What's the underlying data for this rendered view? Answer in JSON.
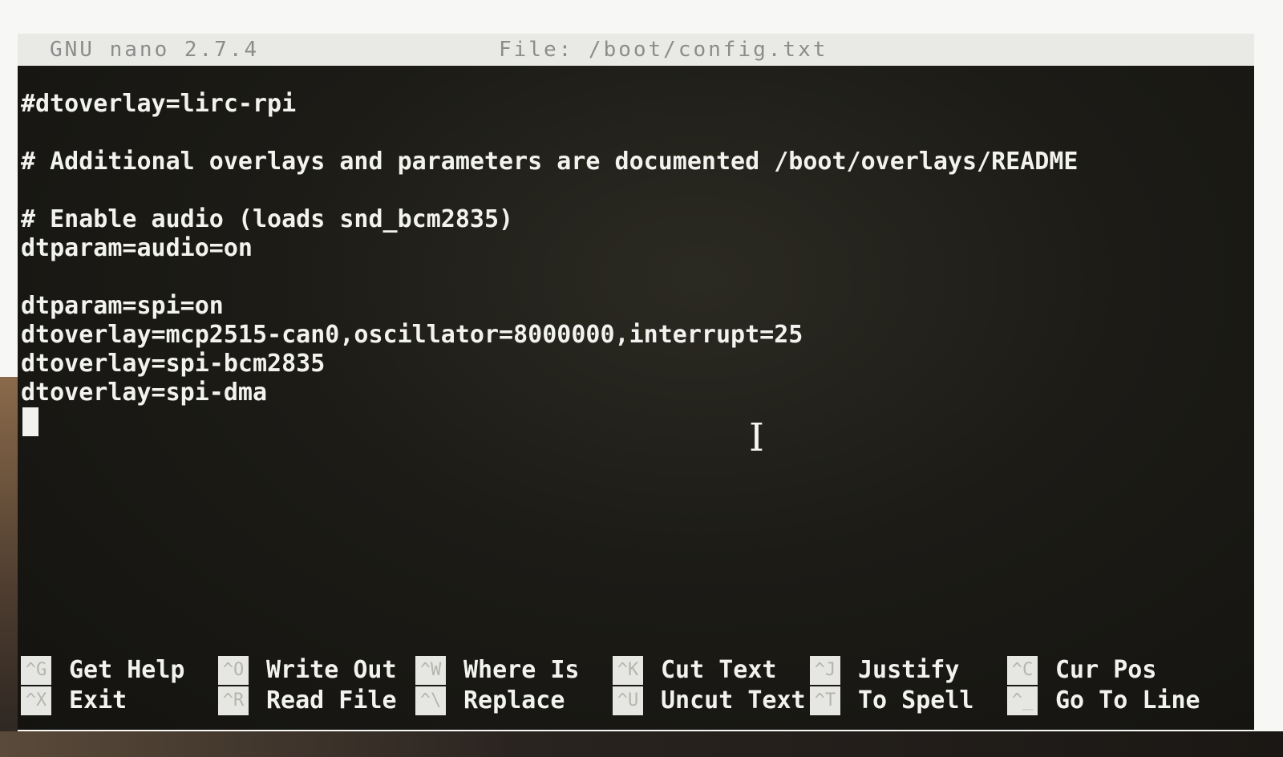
{
  "titlebar": {
    "app": "GNU nano 2.7.4",
    "file": "File: /boot/config.txt"
  },
  "editor": {
    "lines": [
      "#dtoverlay=lirc-rpi",
      "",
      "# Additional overlays and parameters are documented /boot/overlays/README",
      "",
      "# Enable audio (loads snd_bcm2835)",
      "dtparam=audio=on",
      "",
      "dtparam=spi=on",
      "dtoverlay=mcp2515-can0,oscillator=8000000,interrupt=25",
      "dtoverlay=spi-bcm2835",
      "dtoverlay=spi-dma"
    ]
  },
  "mouse": {
    "ibeam_glyph": "I"
  },
  "shortcuts": {
    "get_help": {
      "key": "^G",
      "label": "Get Help"
    },
    "exit": {
      "key": "^X",
      "label": "Exit"
    },
    "write_out": {
      "key": "^O",
      "label": "Write Out"
    },
    "read_file": {
      "key": "^R",
      "label": "Read File"
    },
    "where_is": {
      "key": "^W",
      "label": "Where Is"
    },
    "replace": {
      "key": "^\\",
      "label": "Replace"
    },
    "cut_text": {
      "key": "^K",
      "label": "Cut Text"
    },
    "uncut_text": {
      "key": "^U",
      "label": "Uncut Text"
    },
    "justify": {
      "key": "^J",
      "label": "Justify"
    },
    "to_spell": {
      "key": "^T",
      "label": "To Spell"
    },
    "cur_pos": {
      "key": "^C",
      "label": "Cur Pos"
    },
    "go_to_line": {
      "key": "^_",
      "label": "Go To Line"
    }
  },
  "colors": {
    "screen_bg": "#1c1b16",
    "text": "#f2f2ee",
    "titlebar_bg": "#e9e9e6",
    "titlebar_text": "#8c8c8c"
  }
}
